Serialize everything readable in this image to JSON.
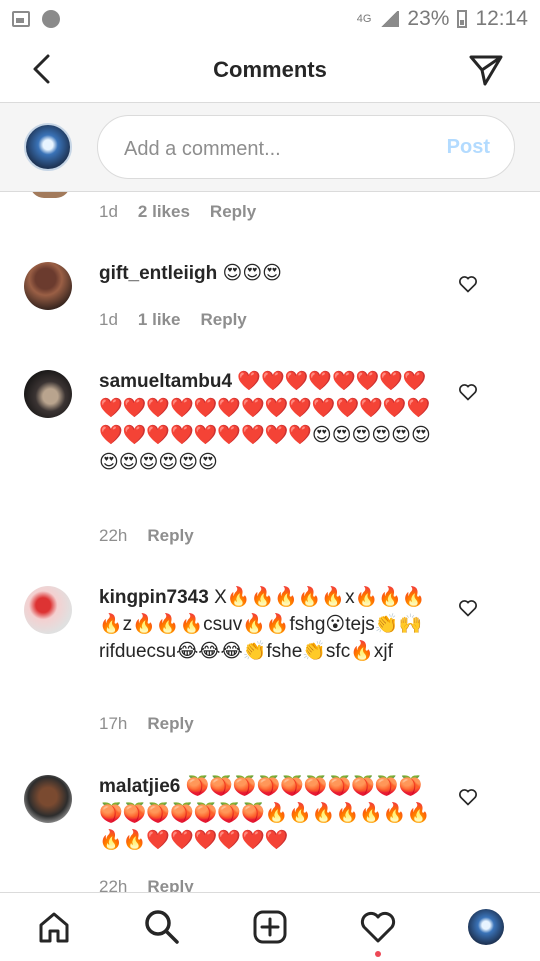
{
  "status_bar": {
    "network": "4G",
    "battery": "23%",
    "time": "12:14"
  },
  "header": {
    "title": "Comments"
  },
  "compose": {
    "placeholder": "Add a comment...",
    "post_label": "Post"
  },
  "top_comment_meta": {
    "time": "1d",
    "likes": "2 likes",
    "reply": "Reply"
  },
  "comments": [
    {
      "username": "gift_entleiigh",
      "text": "😍😍😍",
      "time": "1d",
      "likes": "1 like",
      "reply": "Reply"
    },
    {
      "username": "samueltambu4",
      "text": "❤️❤️❤️❤️❤️❤️❤️❤️❤️❤️❤️❤️❤️❤️❤️❤️❤️❤️❤️❤️❤️❤️❤️❤️❤️❤️❤️❤️❤️❤️❤️😍😍😍😍😍😍😍😍😍😍😍😍",
      "time": "22h",
      "reply": "Reply"
    },
    {
      "username": "kingpin7343",
      "text": "X🔥🔥🔥🔥🔥x🔥🔥🔥🔥z🔥🔥🔥csuv🔥🔥fshg😮tejs👏🙌rifduecsu😂😂😂👏fshe👏sfc🔥xjf",
      "time": "17h",
      "reply": "Reply"
    },
    {
      "username": "malatjie6",
      "text": "🍑🍑🍑🍑🍑🍑🍑🍑🍑🍑🍑🍑🍑🍑🍑🍑🍑🔥🔥🔥🔥🔥🔥🔥🔥🔥❤️❤️❤️❤️❤️❤️",
      "time": "22h",
      "reply": "Reply"
    }
  ]
}
